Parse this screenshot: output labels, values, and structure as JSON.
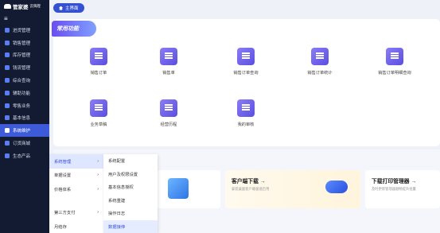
{
  "app": {
    "name": "管家婆",
    "subtitle": "云辉煌"
  },
  "colors": {
    "sidebar_bg": "#131b33",
    "accent": "#3d5bd9",
    "tile_icon": "#6a5cf0"
  },
  "sidebar": {
    "items": [
      {
        "label": "进货管理",
        "icon": "purchase-icon"
      },
      {
        "label": "销售管理",
        "icon": "sales-icon"
      },
      {
        "label": "库存管理",
        "icon": "inventory-icon"
      },
      {
        "label": "钱流管理",
        "icon": "cashflow-icon"
      },
      {
        "label": "综合查询",
        "icon": "query-icon"
      },
      {
        "label": "辅助功能",
        "icon": "assist-icon"
      },
      {
        "label": "零售业务",
        "icon": "retail-icon"
      },
      {
        "label": "基本信息",
        "icon": "basic-info-icon"
      },
      {
        "label": "系统维护",
        "icon": "system-icon"
      },
      {
        "label": "订货商城",
        "icon": "mall-icon"
      },
      {
        "label": "生态产品",
        "icon": "ecosystem-icon"
      }
    ]
  },
  "topbar": {
    "home_label": "主界面"
  },
  "common": {
    "title": "常用功能",
    "tiles": [
      {
        "label": "销售订单",
        "icon": "sales-order-icon"
      },
      {
        "label": "销售单",
        "icon": "sales-doc-icon"
      },
      {
        "label": "销售订单查询",
        "icon": "order-query-icon"
      },
      {
        "label": "销售订单统计",
        "icon": "order-stats-icon"
      },
      {
        "label": "销售订单明细查询",
        "icon": "order-detail-icon"
      },
      {
        "label": "业务草稿",
        "icon": "draft-icon"
      },
      {
        "label": "经营历程",
        "icon": "history-icon"
      },
      {
        "label": "我的审核",
        "icon": "audit-icon"
      }
    ]
  },
  "promos": [
    {
      "title": "客户端下载 →",
      "sub": "安装桌面客户端极速启用"
    },
    {
      "title": "下载打印管理器 →",
      "sub": "及时更新管理器顺畅提升批量"
    }
  ],
  "submenu1": {
    "items": [
      {
        "label": "系统管理",
        "arrow": "›"
      },
      {
        "label": "单据设置",
        "arrow": "›"
      },
      {
        "label": "价格体系",
        "arrow": "›"
      },
      {
        "label": "第三方支付",
        "arrow": "›"
      },
      {
        "label": "月结存",
        "arrow": ""
      }
    ]
  },
  "submenu2": {
    "items": [
      {
        "label": "系统配置"
      },
      {
        "label": "用户及权限设置"
      },
      {
        "label": "基本信息授权"
      },
      {
        "label": "系统重建"
      },
      {
        "label": "操作日志"
      },
      {
        "label": "数据接停"
      }
    ]
  }
}
